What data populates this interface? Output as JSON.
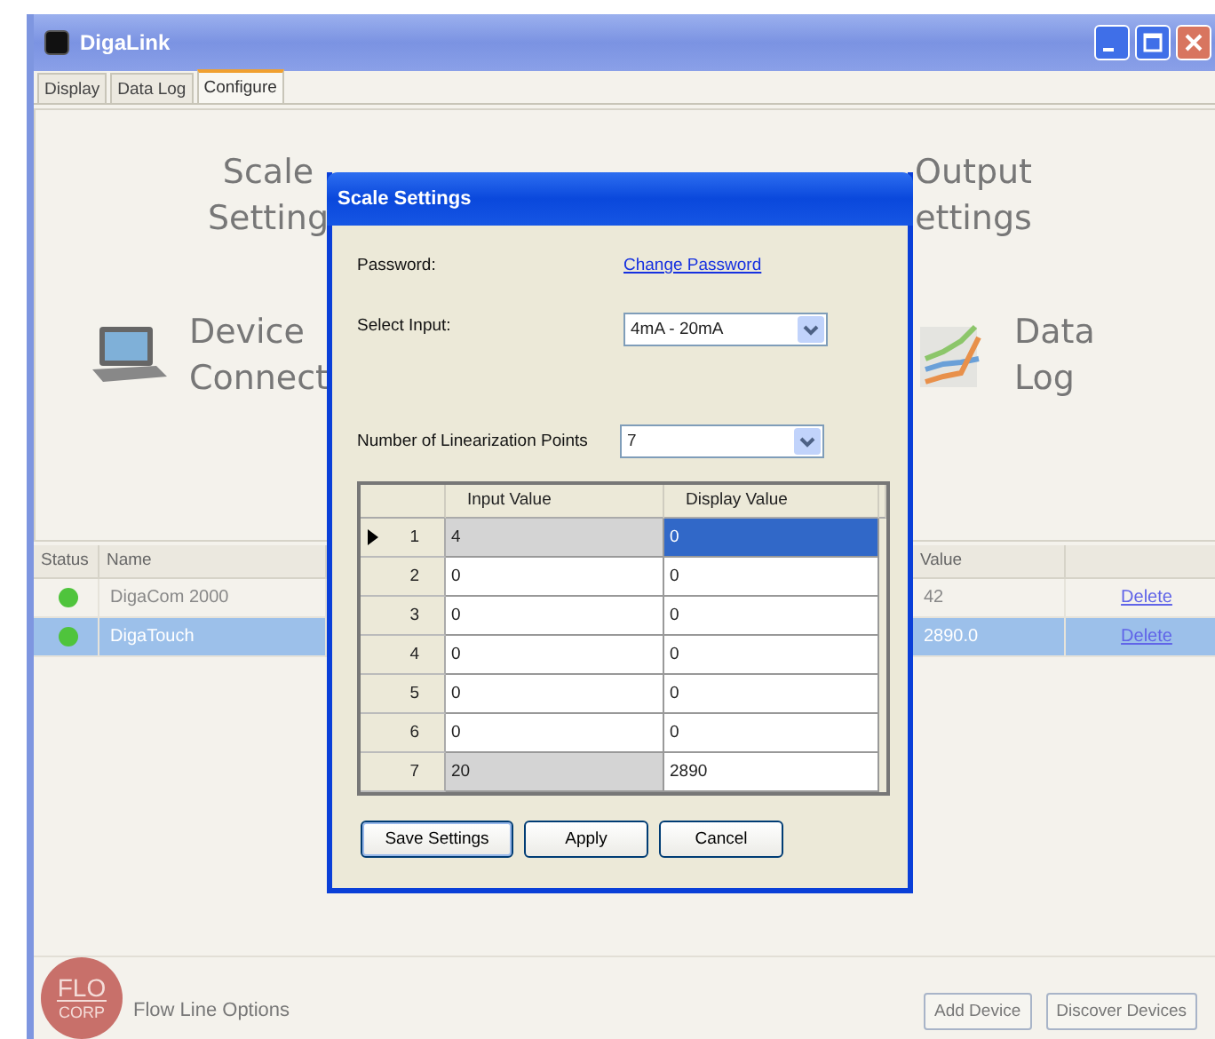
{
  "window": {
    "title": "DigaLink"
  },
  "tabs": [
    {
      "label": "Display",
      "selected": false
    },
    {
      "label": "Data Log",
      "selected": false
    },
    {
      "label": "Configure",
      "selected": true
    }
  ],
  "tiles": {
    "left": [
      {
        "kind": "text",
        "lines": [
          "Scale",
          "Setting"
        ]
      },
      {
        "kind": "device",
        "lines": [
          "Device",
          "Connect"
        ]
      }
    ],
    "right": [
      {
        "kind": "text",
        "lines": [
          "Output",
          "ettings"
        ]
      },
      {
        "kind": "chart",
        "lines": [
          "Data",
          "Log"
        ]
      }
    ]
  },
  "devices": {
    "columns": [
      "Status",
      "Name",
      "Value"
    ],
    "rows": [
      {
        "name": "DigaCom 2000",
        "value": "42",
        "action": "Delete",
        "online": true,
        "selected": false
      },
      {
        "name": "DigaTouch",
        "value": "2890.0",
        "action": "Delete",
        "online": true,
        "selected": true
      }
    ]
  },
  "footer": {
    "logo_top": "FLO",
    "logo_bottom": "CORP",
    "brand": "Flow Line Options",
    "buttons": [
      "Add Device",
      "Discover Devices"
    ]
  },
  "dialog": {
    "title": "Scale Settings",
    "password_label": "Password:",
    "password_link": "Change Password",
    "input_label": "Select Input:",
    "input_value": "4mA - 20mA",
    "points_label": "Number of Linearization Points",
    "points_value": "7",
    "columns": [
      "Input Value",
      "Display Value"
    ],
    "rows": [
      {
        "index": "1",
        "input": "4",
        "display": "0",
        "current": true,
        "input_readonly": true,
        "display_selected": true
      },
      {
        "index": "2",
        "input": "0",
        "display": "0",
        "current": false,
        "input_readonly": false,
        "display_selected": false
      },
      {
        "index": "3",
        "input": "0",
        "display": "0",
        "current": false,
        "input_readonly": false,
        "display_selected": false
      },
      {
        "index": "4",
        "input": "0",
        "display": "0",
        "current": false,
        "input_readonly": false,
        "display_selected": false
      },
      {
        "index": "5",
        "input": "0",
        "display": "0",
        "current": false,
        "input_readonly": false,
        "display_selected": false
      },
      {
        "index": "6",
        "input": "0",
        "display": "0",
        "current": false,
        "input_readonly": false,
        "display_selected": false
      },
      {
        "index": "7",
        "input": "20",
        "display": "2890",
        "current": false,
        "input_readonly": true,
        "display_selected": false
      }
    ],
    "buttons": [
      {
        "label": "Save Settings",
        "focused": true
      },
      {
        "label": "Apply",
        "focused": false
      },
      {
        "label": "Cancel",
        "focused": false
      }
    ]
  }
}
